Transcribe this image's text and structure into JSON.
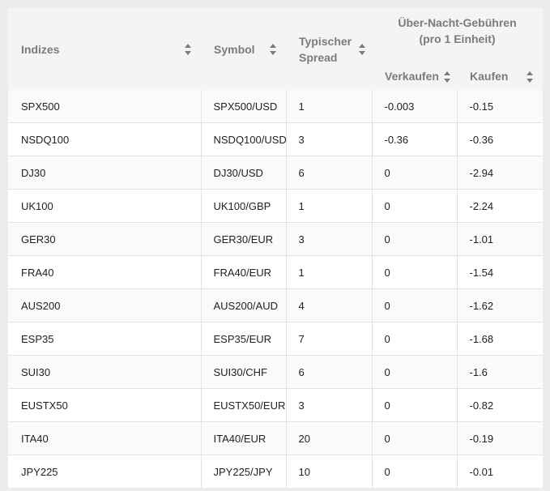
{
  "header": {
    "indizes": "Indizes",
    "symbol": "Symbol",
    "spread_line1": "Typischer",
    "spread_line2": "Spread",
    "fees_line1": "Über-Nacht-Gebühren",
    "fees_line2": "(pro 1 Einheit)",
    "sell": "Verkaufen",
    "buy": "Kaufen"
  },
  "rows": [
    {
      "index": "SPX500",
      "symbol": "SPX500/USD",
      "spread": "1",
      "sell": "-0.003",
      "buy": "-0.15"
    },
    {
      "index": "NSDQ100",
      "symbol": "NSDQ100/USD",
      "spread": "3",
      "sell": "-0.36",
      "buy": "-0.36"
    },
    {
      "index": "DJ30",
      "symbol": "DJ30/USD",
      "spread": "6",
      "sell": "0",
      "buy": "-2.94"
    },
    {
      "index": "UK100",
      "symbol": "UK100/GBP",
      "spread": "1",
      "sell": "0",
      "buy": "-2.24"
    },
    {
      "index": "GER30",
      "symbol": "GER30/EUR",
      "spread": "3",
      "sell": "0",
      "buy": "-1.01"
    },
    {
      "index": "FRA40",
      "symbol": "FRA40/EUR",
      "spread": "1",
      "sell": "0",
      "buy": "-1.54"
    },
    {
      "index": "AUS200",
      "symbol": "AUS200/AUD",
      "spread": "4",
      "sell": "0",
      "buy": "-1.62"
    },
    {
      "index": "ESP35",
      "symbol": "ESP35/EUR",
      "spread": "7",
      "sell": "0",
      "buy": "-1.68"
    },
    {
      "index": "SUI30",
      "symbol": "SUI30/CHF",
      "spread": "6",
      "sell": "0",
      "buy": "-1.6"
    },
    {
      "index": "EUSTX50",
      "symbol": "EUSTX50/EUR",
      "spread": "3",
      "sell": "0",
      "buy": "-0.82"
    },
    {
      "index": "ITA40",
      "symbol": "ITA40/EUR",
      "spread": "20",
      "sell": "0",
      "buy": "-0.19"
    },
    {
      "index": "JPY225",
      "symbol": "JPY225/JPY",
      "spread": "10",
      "sell": "0",
      "buy": "-0.01"
    }
  ],
  "icons": {
    "sort": "sort-arrows-icon"
  },
  "colors": {
    "header_text": "#7b7b7b",
    "header_bg": "#f4f4f4",
    "row_alt_bg": "#fafafa",
    "border": "#e2e2e2",
    "page_bg": "#ececec"
  }
}
